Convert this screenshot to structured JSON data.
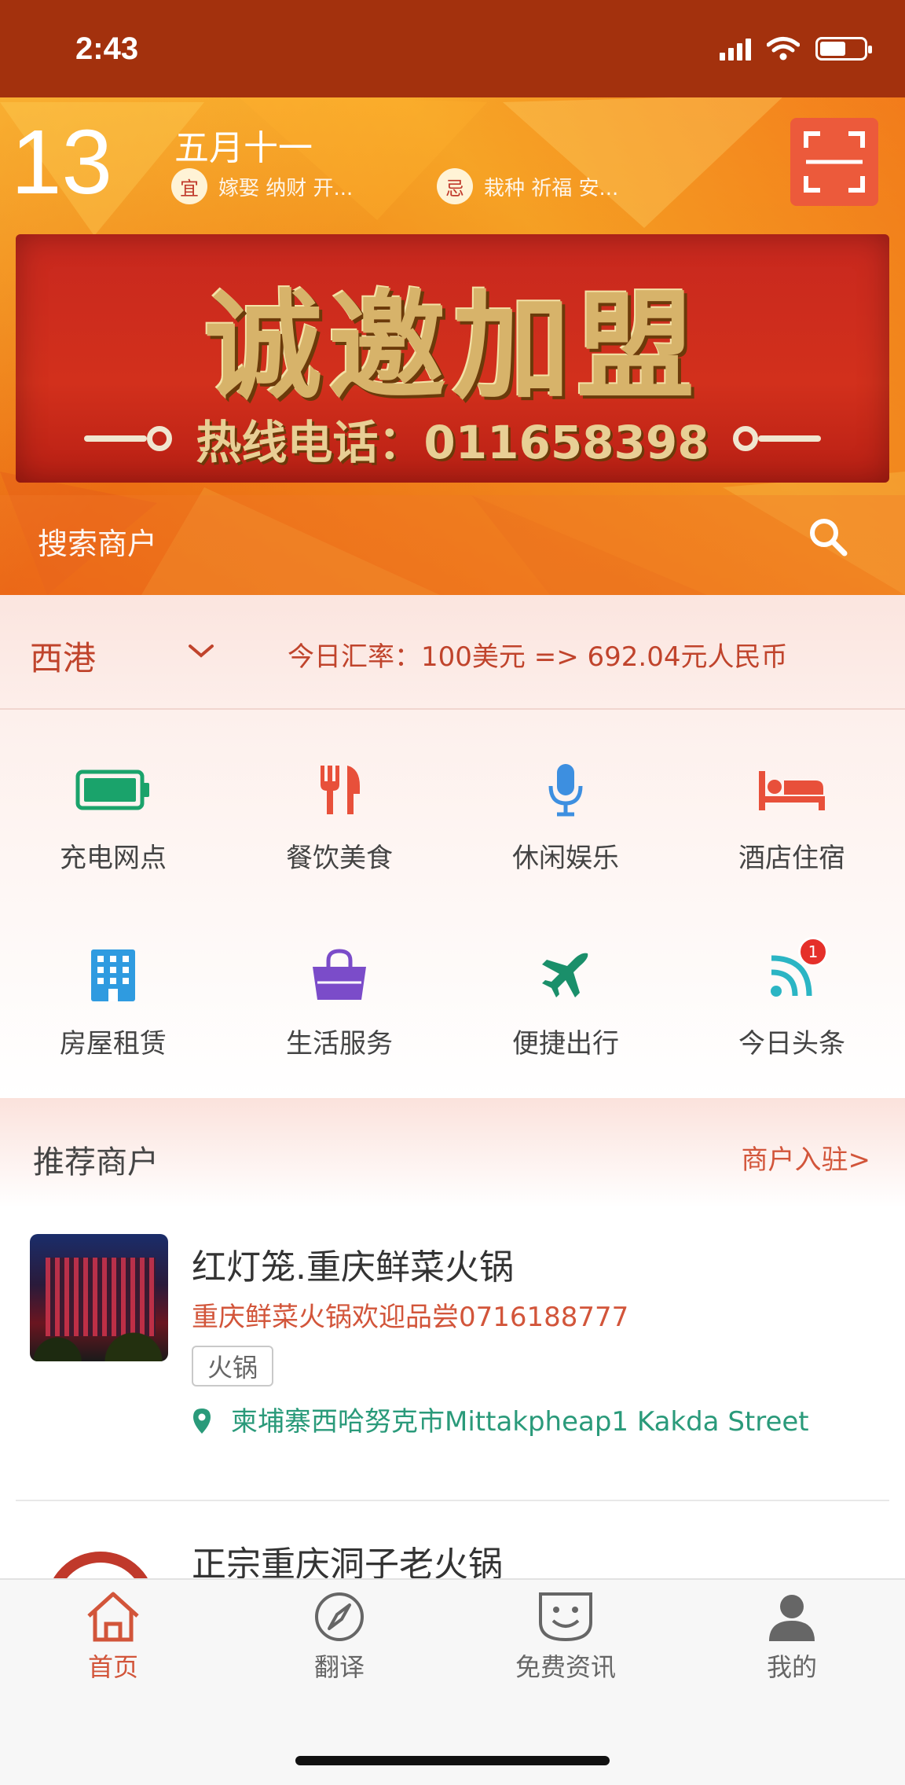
{
  "status_bar": {
    "time": "2:43"
  },
  "almanac": {
    "day": "13",
    "lunar_date": "五月十一",
    "good_badge": "宜",
    "good_text": "嫁娶 纳财 开...",
    "bad_badge": "忌",
    "bad_text": "栽种 祈福 安..."
  },
  "banner": {
    "title": "诚邀加盟",
    "hotline": "热线电话：011658398"
  },
  "search": {
    "placeholder": "搜索商户"
  },
  "location": {
    "city": "西港",
    "rate": "今日汇率：100美元 => 692.04元人民币"
  },
  "categories": [
    {
      "label": "充电网点",
      "icon": "battery-icon",
      "color": "#1aa36b"
    },
    {
      "label": "餐饮美食",
      "icon": "fork-knife-icon",
      "color": "#e8503a"
    },
    {
      "label": "休闲娱乐",
      "icon": "microphone-icon",
      "color": "#3d8fe0"
    },
    {
      "label": "酒店住宿",
      "icon": "bed-icon",
      "color": "#e8503a"
    },
    {
      "label": "房屋租赁",
      "icon": "building-icon",
      "color": "#2f9be0"
    },
    {
      "label": "生活服务",
      "icon": "shopping-bag-icon",
      "color": "#7b4cc9"
    },
    {
      "label": "便捷出行",
      "icon": "airplane-icon",
      "color": "#1a8f6a"
    },
    {
      "label": "今日头条",
      "icon": "rss-icon",
      "color": "#2bb5c4",
      "badge": "1"
    }
  ],
  "recommended": {
    "title": "推荐商户",
    "join_link": "商户入驻>",
    "merchants": [
      {
        "name": "红灯笼.重庆鲜菜火锅",
        "description": "重庆鲜菜火锅欢迎品尝0716188777",
        "tag": "火锅",
        "address": "柬埔寨西哈努克市Mittakpheap1 Kakda Street"
      },
      {
        "name": "正宗重庆洞子老火锅"
      }
    ]
  },
  "tab_bar": {
    "items": [
      {
        "label": "首页",
        "icon": "home-icon",
        "active": true
      },
      {
        "label": "翻译",
        "icon": "compass-icon",
        "active": false
      },
      {
        "label": "免费资讯",
        "icon": "smiley-tv-icon",
        "active": false
      },
      {
        "label": "我的",
        "icon": "user-icon",
        "active": false
      }
    ]
  },
  "colors": {
    "status_bar": "#a3310d",
    "accent": "#d2553a",
    "address_green": "#2a9a7a"
  }
}
